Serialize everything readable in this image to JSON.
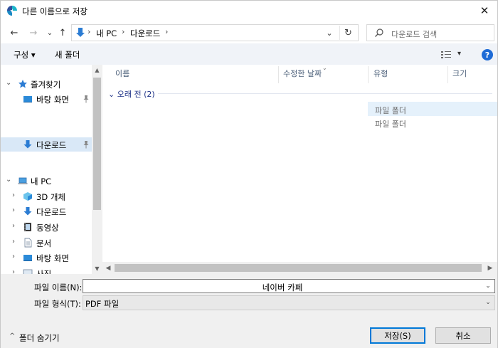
{
  "window": {
    "title": "다른 이름으로 저장",
    "close_glyph": "✕"
  },
  "nav": {
    "back_glyph": "←",
    "forward_glyph": "→",
    "recent_glyph": "⌄",
    "up_glyph": "↑",
    "breadcrumbs": [
      "내 PC",
      "다운로드"
    ],
    "crumb_sep": "›",
    "dropdown_glyph": "⌄",
    "refresh_glyph": "↻"
  },
  "search": {
    "placeholder": "다운로드 검색"
  },
  "toolbar": {
    "organize_label": "구성 ▾",
    "new_folder_label": "새 폴더",
    "view_glyph": "▾",
    "help_glyph": "?"
  },
  "navpane": {
    "quick_access": {
      "label": "즐겨찾기",
      "chevron": "⌄"
    },
    "quick_items": [
      {
        "label": "바탕 화면",
        "icon": "desktop-icon",
        "pinned": true
      },
      {
        "label": "다운로드",
        "icon": "download-icon",
        "pinned": true,
        "selected": true
      }
    ],
    "this_pc": {
      "label": "내 PC",
      "chevron": "⌄"
    },
    "pc_items": [
      {
        "label": "3D 개체",
        "icon": "3d-objects-icon"
      },
      {
        "label": "다운로드",
        "icon": "download-icon"
      },
      {
        "label": "동영상",
        "icon": "video-icon"
      },
      {
        "label": "문서",
        "icon": "document-icon"
      },
      {
        "label": "바탕 화면",
        "icon": "desktop-icon"
      },
      {
        "label": "사진",
        "icon": "picture-icon"
      }
    ],
    "child_chevron": "›"
  },
  "filelist": {
    "columns": [
      "이름",
      "수정한 날짜",
      "유형",
      "크기"
    ],
    "group": {
      "label": "⌄  오래 전 (2)"
    },
    "rows": [
      {
        "type": "파일 폴더"
      },
      {
        "type": "파일 폴더"
      }
    ]
  },
  "bottom": {
    "filename_label": "파일 이름(N):",
    "filename_value": "네이버 카페",
    "filetype_label": "파일 형식(T):",
    "filetype_value": "PDF 파일",
    "dd_glyph": "⌄",
    "hide_folders_label": "폴더 숨기기",
    "hide_chevron": "^",
    "save_label": "저장(S)",
    "cancel_label": "취소"
  },
  "colors": {
    "accent": "#0078d7",
    "selected_bg": "#d9e8f7",
    "toolbar_bg": "#f0f3f8",
    "help_blue": "#1e6bd6"
  }
}
